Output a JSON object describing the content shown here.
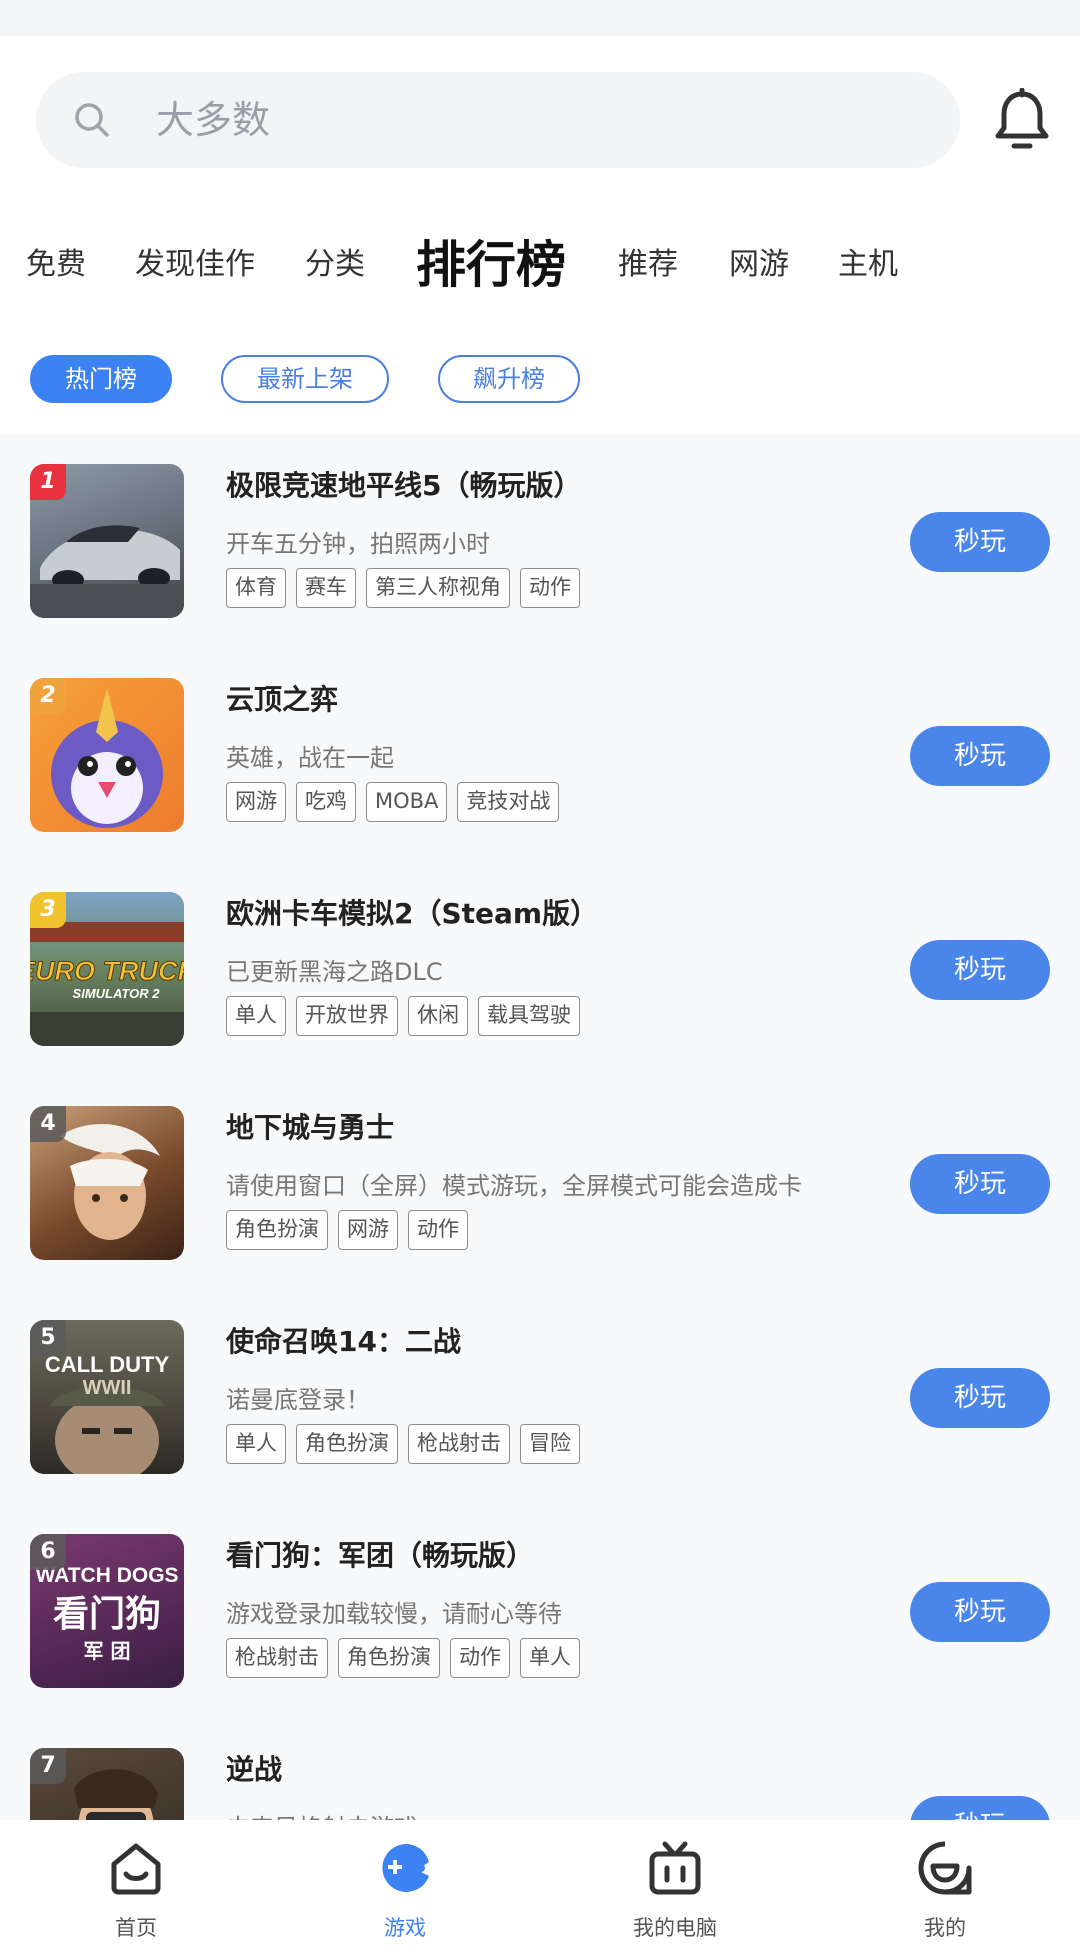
{
  "search": {
    "placeholder": "大多数"
  },
  "tabs": [
    {
      "label": "免费"
    },
    {
      "label": "发现佳作"
    },
    {
      "label": "分类"
    },
    {
      "label": "排行榜"
    },
    {
      "label": "推荐"
    },
    {
      "label": "网游"
    },
    {
      "label": "主机"
    }
  ],
  "chips": [
    {
      "label": "热门榜"
    },
    {
      "label": "最新上架"
    },
    {
      "label": "飙升榜"
    }
  ],
  "games": [
    {
      "rank": "1",
      "title": "极限竞速地平线5（畅玩版）",
      "subtitle": "开车五分钟，拍照两小时",
      "tags": [
        "体育",
        "赛车",
        "第三人称视角",
        "动作"
      ],
      "button": "秒玩"
    },
    {
      "rank": "2",
      "title": "云顶之弈",
      "subtitle": "英雄，战在一起",
      "tags": [
        "网游",
        "吃鸡",
        "MOBA",
        "竞技对战"
      ],
      "button": "秒玩"
    },
    {
      "rank": "3",
      "title": "欧洲卡车模拟2（Steam版）",
      "subtitle": "已更新黑海之路DLC",
      "tags": [
        "单人",
        "开放世界",
        "休闲",
        "载具驾驶"
      ],
      "button": "秒玩",
      "thumb_text": [
        "EURO TRUCK",
        "SIMULATOR 2"
      ]
    },
    {
      "rank": "4",
      "title": "地下城与勇士",
      "subtitle": "请使用窗口（全屏）模式游玩，全屏模式可能会造成卡",
      "tags": [
        "角色扮演",
        "网游",
        "动作"
      ],
      "button": "秒玩"
    },
    {
      "rank": "5",
      "title": "使命召唤14：二战",
      "subtitle": "诺曼底登录！",
      "tags": [
        "单人",
        "角色扮演",
        "枪战射击",
        "冒险"
      ],
      "button": "秒玩",
      "thumb_text": [
        "CALL DUTY",
        "WWII"
      ]
    },
    {
      "rank": "6",
      "title": "看门狗：军团（畅玩版）",
      "subtitle": "游戏登录加载较慢，请耐心等待",
      "tags": [
        "枪战射击",
        "角色扮演",
        "动作",
        "单人"
      ],
      "button": "秒玩",
      "thumb_text": [
        "WATCH DOGS",
        "看门狗",
        "军 团"
      ]
    },
    {
      "rank": "7",
      "title": "逆战",
      "subtitle": "未来风格射击游戏",
      "tags": [],
      "button": "秒玩"
    }
  ],
  "bottom_nav": [
    {
      "label": "首页",
      "icon": "home-icon"
    },
    {
      "label": "游戏",
      "icon": "game-icon"
    },
    {
      "label": "我的电脑",
      "icon": "tv-icon"
    },
    {
      "label": "我的",
      "icon": "profile-icon"
    }
  ],
  "colors": {
    "accent": "#3d82f4",
    "button": "#4a86ea",
    "rank1": "#e8323f",
    "rank2": "#f2a23c",
    "rank3": "#f0c22e"
  }
}
